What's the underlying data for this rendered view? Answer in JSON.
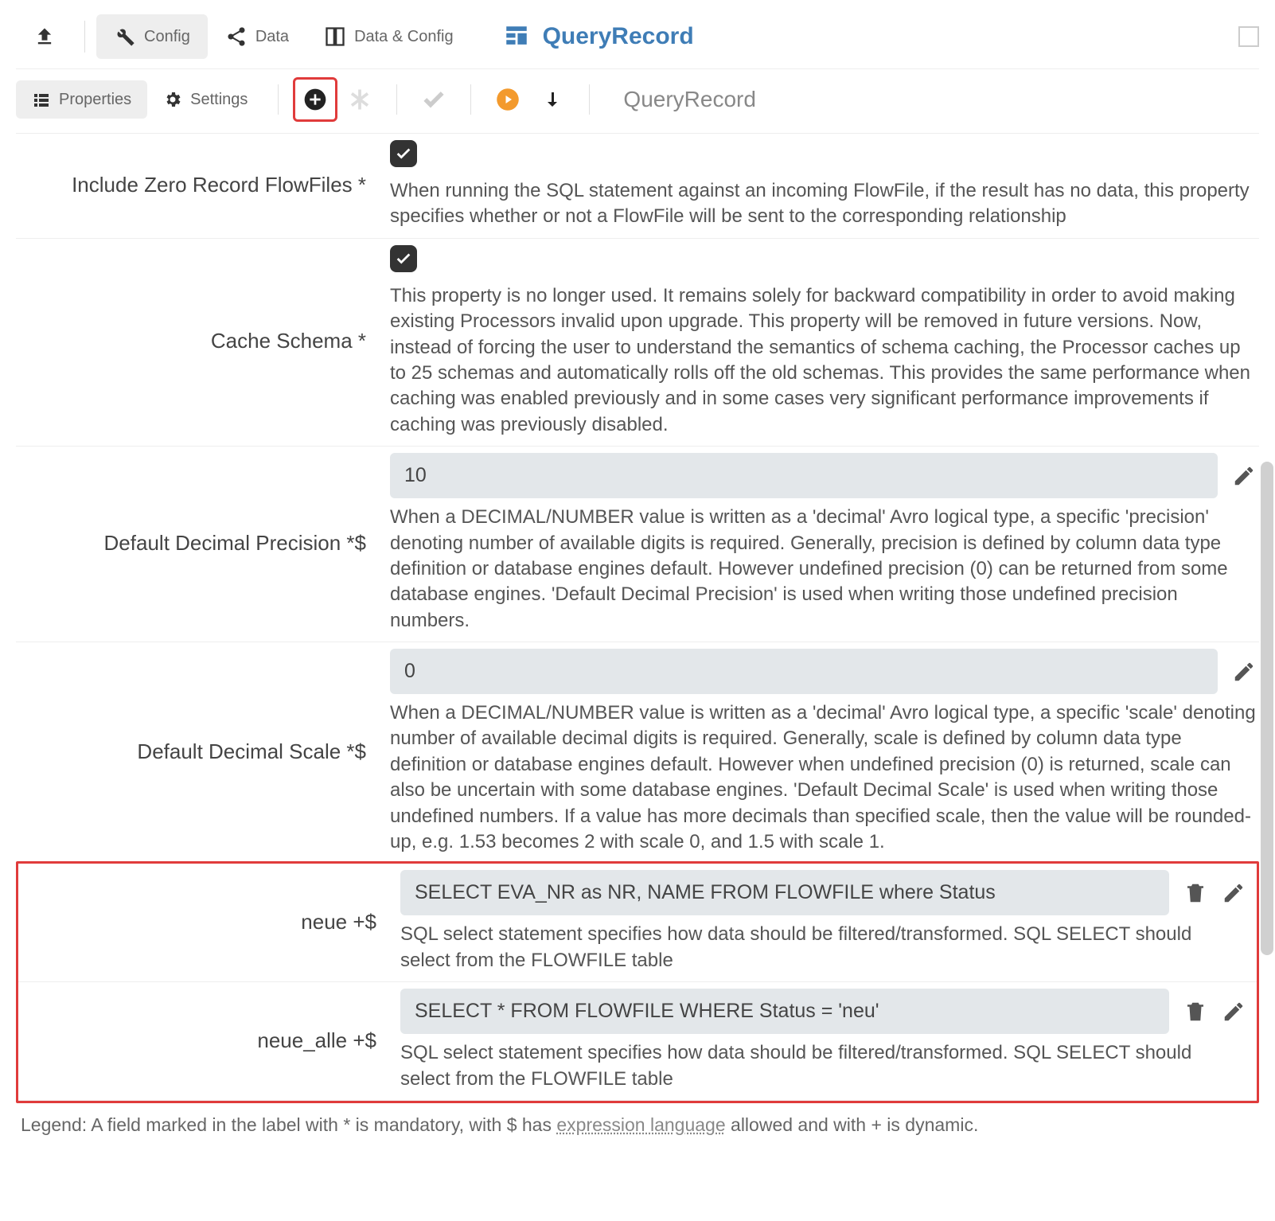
{
  "header": {
    "tabs": [
      {
        "id": "upload",
        "label": ""
      },
      {
        "id": "config",
        "label": "Config"
      },
      {
        "id": "data",
        "label": "Data"
      },
      {
        "id": "dataconfig",
        "label": "Data & Config"
      }
    ],
    "app_name": "QueryRecord"
  },
  "header2": {
    "tabs": [
      {
        "id": "properties",
        "label": "Properties"
      },
      {
        "id": "settings",
        "label": "Settings"
      }
    ],
    "breadcrumb": "QueryRecord"
  },
  "props": [
    {
      "id": "include_zero",
      "label": "Include Zero Record FlowFiles *",
      "checked": true,
      "value": null,
      "desc": "When running the SQL statement against an incoming FlowFile, if the result has no data, this property specifies whether or not a FlowFile will be sent to the corresponding relationship"
    },
    {
      "id": "cache_schema",
      "label": "Cache Schema *",
      "checked": true,
      "value": null,
      "desc": "This property is no longer used. It remains solely for backward compatibility in order to avoid making existing Processors invalid upon upgrade. This property will be removed in future versions. Now, instead of forcing the user to understand the semantics of schema caching, the Processor caches up to 25 schemas and automatically rolls off the old schemas. This provides the same performance when caching was enabled previously and in some cases very significant performance improvements if caching was previously disabled."
    },
    {
      "id": "dec_precision",
      "label": "Default Decimal Precision *$",
      "checked": false,
      "value": "10",
      "deletable": false,
      "desc": "When a DECIMAL/NUMBER value is written as a 'decimal' Avro logical type, a specific 'precision' denoting number of available digits is required. Generally, precision is defined by column data type definition or database engines default. However undefined precision (0) can be returned from some database engines. 'Default Decimal Precision' is used when writing those undefined precision numbers."
    },
    {
      "id": "dec_scale",
      "label": "Default Decimal Scale *$",
      "checked": false,
      "value": "0",
      "deletable": false,
      "desc": "When a DECIMAL/NUMBER value is written as a 'decimal' Avro logical type, a specific 'scale' denoting number of available decimal digits is required. Generally, scale is defined by column data type definition or database engines default. However when undefined precision (0) is returned, scale can also be uncertain with some database engines. 'Default Decimal Scale' is used when writing those undefined numbers. If a value has more decimals than specified scale, then the value will be rounded-up, e.g. 1.53 becomes 2 with scale 0, and 1.5 with scale 1."
    }
  ],
  "dynamic_props": [
    {
      "id": "neue",
      "label": "neue +$",
      "value": "SELECT EVA_NR as NR, NAME FROM FLOWFILE where Status",
      "deletable": true,
      "desc": "SQL select statement specifies how data should be filtered/transformed. SQL SELECT should select from the FLOWFILE table"
    },
    {
      "id": "neue_alle",
      "label": "neue_alle +$",
      "value": "SELECT * FROM FLOWFILE WHERE Status = 'neu'",
      "deletable": true,
      "desc": "SQL select statement specifies how data should be filtered/transformed. SQL SELECT should select from the FLOWFILE table"
    }
  ],
  "legend": {
    "pre": "Legend: A field marked in the label with * is mandatory, with $ has ",
    "link": "expression language",
    "post": " allowed and with + is dynamic."
  }
}
